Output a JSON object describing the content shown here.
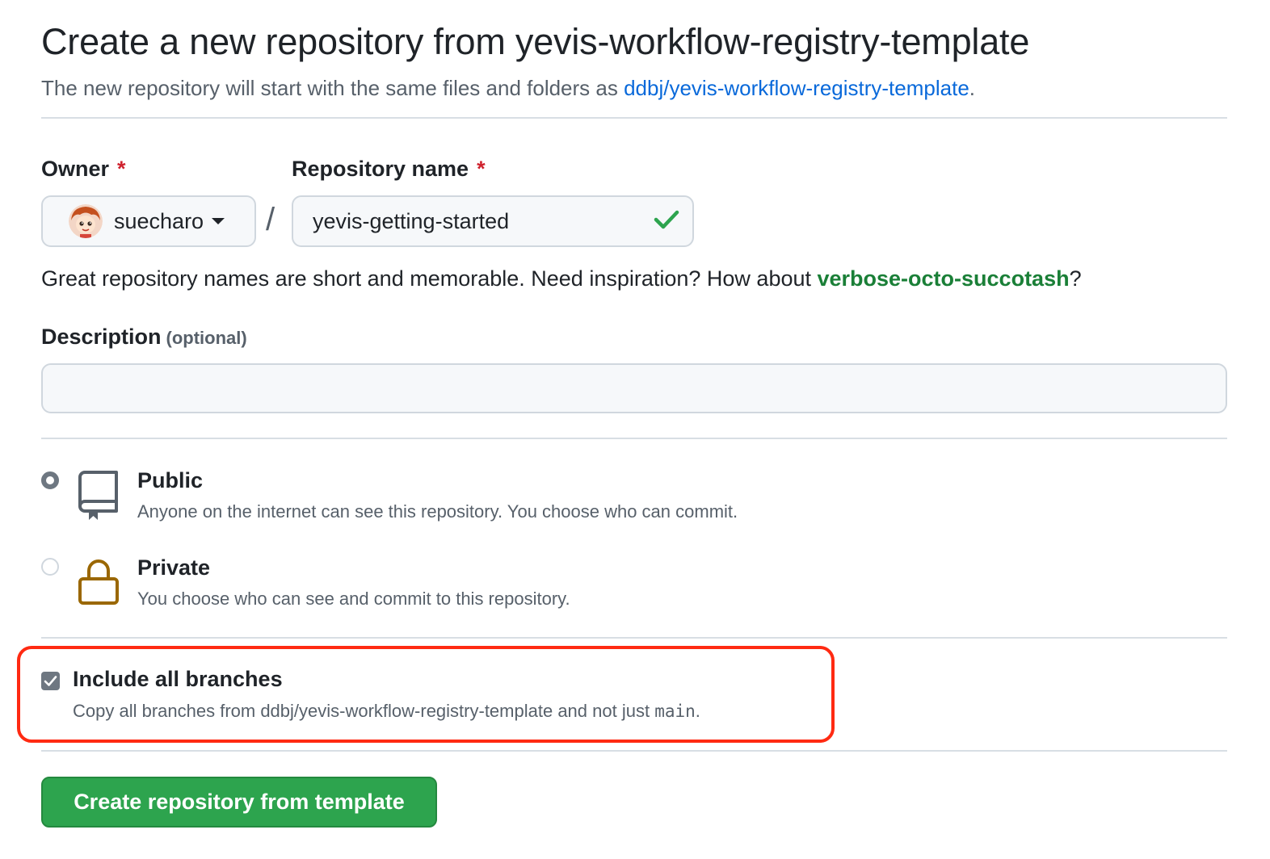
{
  "header": {
    "title": "Create a new repository from yevis-workflow-registry-template",
    "subtitle_prefix": "The new repository will start with the same files and folders as ",
    "subtitle_link": "ddbj/yevis-workflow-registry-template",
    "subtitle_suffix": "."
  },
  "owner": {
    "label": "Owner",
    "required_mark": "*",
    "value": "suecharo"
  },
  "separator": "/",
  "repository": {
    "label": "Repository name",
    "required_mark": "*",
    "value": "yevis-getting-started",
    "valid": true
  },
  "name_hint": {
    "prefix": "Great repository names are short and memorable. Need inspiration? How about ",
    "suggestion": "verbose-octo-succotash",
    "suffix": "?"
  },
  "description": {
    "label": "Description",
    "optional": "(optional)",
    "value": ""
  },
  "visibility": {
    "selected": "public",
    "public": {
      "title": "Public",
      "description": "Anyone on the internet can see this repository. You choose who can commit.",
      "icon": "repo-icon"
    },
    "private": {
      "title": "Private",
      "description": "You choose who can see and commit to this repository.",
      "icon": "lock-icon"
    }
  },
  "include_branches": {
    "checked": true,
    "title": "Include all branches",
    "description_prefix": "Copy all branches from ddbj/yevis-workflow-registry-template and not just ",
    "branch": "main",
    "description_suffix": "."
  },
  "submit": {
    "label": "Create repository from template"
  },
  "colors": {
    "link": "#0969da",
    "suggestion": "#1a7f37",
    "button": "#2da44e",
    "required": "#cf222e",
    "highlight": "#ff2a12"
  }
}
